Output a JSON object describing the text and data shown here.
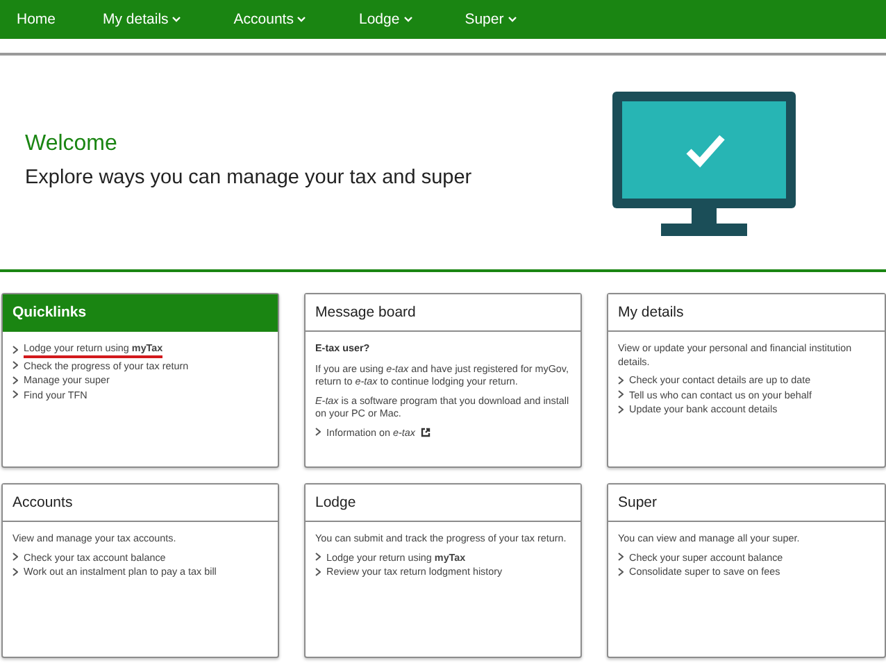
{
  "nav": [
    {
      "label": "Home",
      "dropdown": false
    },
    {
      "label": "My details",
      "dropdown": true
    },
    {
      "label": "Accounts",
      "dropdown": true
    },
    {
      "label": "Lodge",
      "dropdown": true
    },
    {
      "label": "Super",
      "dropdown": true
    }
  ],
  "hero": {
    "title": "Welcome",
    "subtitle": "Explore ways you can manage your tax and super"
  },
  "cards": [
    {
      "title": "Quicklinks",
      "highlighted": true,
      "blocks": [
        {
          "kind": "link",
          "text": "Lodge your return using **myTax**",
          "annotated": true
        },
        {
          "kind": "link",
          "text": "Check the progress of your tax return",
          "annotated": false
        },
        {
          "kind": "link",
          "text": "Manage your super",
          "annotated": false
        },
        {
          "kind": "link",
          "text": "Find your TFN",
          "annotated": false
        }
      ]
    },
    {
      "title": "Message board",
      "highlighted": false,
      "blocks": [
        {
          "kind": "heading",
          "text": "E-tax user?"
        },
        {
          "kind": "text",
          "text": "If you are using *e-tax* and have just registered for myGov, return to *e-tax* to continue lodging your return."
        },
        {
          "kind": "text",
          "text": "*E-tax* is a software program that you download and install on your PC or Mac."
        },
        {
          "kind": "link",
          "text": "Information on *e-tax*",
          "external": true
        }
      ]
    },
    {
      "title": "My details",
      "highlighted": false,
      "blocks": [
        {
          "kind": "text",
          "text": "View or update your personal and financial institution details."
        },
        {
          "kind": "link",
          "text": "Check your contact details are up to date"
        },
        {
          "kind": "link",
          "text": "Tell us who can contact us on your behalf"
        },
        {
          "kind": "link",
          "text": "Update your bank account details"
        }
      ]
    },
    {
      "title": "Accounts",
      "highlighted": false,
      "blocks": [
        {
          "kind": "text",
          "text": "View and manage your tax accounts."
        },
        {
          "kind": "link",
          "text": "Check your tax account balance"
        },
        {
          "kind": "link",
          "text": "Work out an instalment plan to pay a tax bill"
        }
      ]
    },
    {
      "title": "Lodge",
      "highlighted": false,
      "blocks": [
        {
          "kind": "text",
          "text": "You can submit and track the progress of your tax return."
        },
        {
          "kind": "link",
          "text": "Lodge your return using **myTax**"
        },
        {
          "kind": "link",
          "text": "Review your tax return lodgment history"
        }
      ]
    },
    {
      "title": "Super",
      "highlighted": false,
      "blocks": [
        {
          "kind": "text",
          "text": "You can view and manage all your super."
        },
        {
          "kind": "link",
          "text": "Check your super account balance"
        },
        {
          "kind": "link",
          "text": "Consolidate super to save on fees"
        }
      ]
    }
  ]
}
